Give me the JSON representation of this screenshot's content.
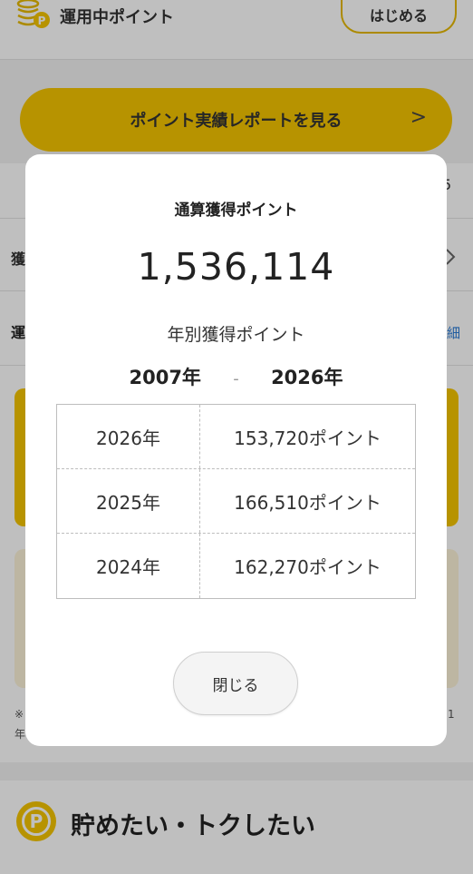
{
  "header": {
    "title": "運用中ポイント",
    "start_label": "はじめる"
  },
  "report_button": {
    "label": "ポイント実績レポートを見る",
    "chevron": ">"
  },
  "background_fragments": {
    "right_digit": "5",
    "row1_left": "獲",
    "row2_left": "運",
    "row2_right": "細",
    "note_left": "※",
    "note_left2": "年",
    "note_right": "1"
  },
  "bottom_section": {
    "icon_letter": "P",
    "title": "貯めたい・トクしたい"
  },
  "modal": {
    "heading": "通算獲得ポイント",
    "total": "1,536,114",
    "subheading": "年別獲得ポイント",
    "range_start": "2007年",
    "range_sep": "-",
    "range_end": "2026年",
    "rows": [
      {
        "year": "2026年",
        "points": "153,720ポイント"
      },
      {
        "year": "2025年",
        "points": "166,510ポイント"
      },
      {
        "year": "2024年",
        "points": "162,270ポイント"
      }
    ],
    "close_label": "閉じる"
  },
  "colors": {
    "accent_yellow": "#f5c400",
    "overlay": "rgba(0,0,0,0.25)"
  }
}
